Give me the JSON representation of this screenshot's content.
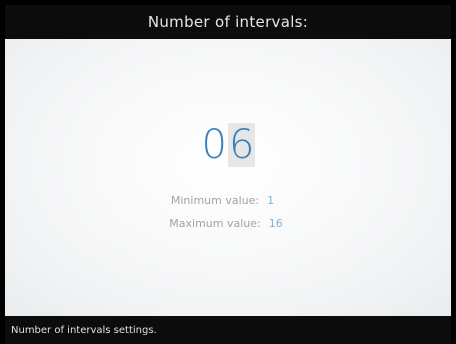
{
  "header": {
    "title": "Number of intervals:"
  },
  "value": {
    "digits": [
      "0",
      "6"
    ],
    "selected_digit_index": 1
  },
  "limits": {
    "min_label": "Minimum value:",
    "min_value": "1",
    "max_label": "Maximum value:",
    "max_value": "16"
  },
  "status": {
    "text": "Number of intervals settings."
  },
  "colors": {
    "value_digits": "#3b80b8",
    "limit_values": "#7fb2d6",
    "labels": "#a3a3a3",
    "bars": "#0c0c0c"
  }
}
